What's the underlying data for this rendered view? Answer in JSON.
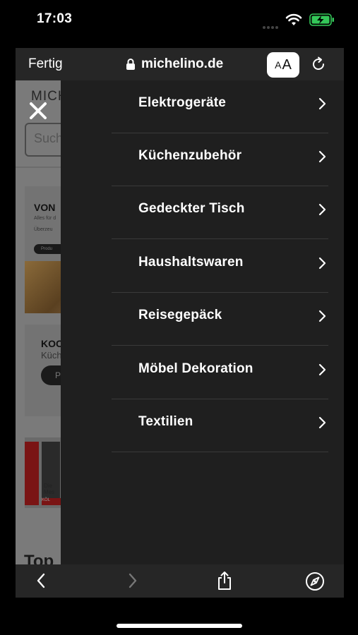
{
  "status": {
    "time": "17:03"
  },
  "safari": {
    "done_label": "Fertig",
    "url": "michelino.de",
    "aa_small": "A",
    "aa_large": "A"
  },
  "page": {
    "logo": "MICH",
    "search_placeholder": "Such",
    "card1_title": "VON",
    "card1_sub": "Alles für d",
    "card1_sub2": "Überzeu",
    "card1_btn": "Produ",
    "card2_title": "KOC",
    "card2_sub": "Küch",
    "card2_btn": "P",
    "card3_text1": "Die",
    "card3_text2": "Mes",
    "card3_bar": "KÖL",
    "heading": "Top"
  },
  "menu": {
    "items": [
      {
        "label": "Elektrogeräte"
      },
      {
        "label": "Küchenzubehör"
      },
      {
        "label": "Gedeckter Tisch"
      },
      {
        "label": "Haushaltswaren"
      },
      {
        "label": "Reisegepäck"
      },
      {
        "label": "Möbel Dekoration"
      },
      {
        "label": "Textilien"
      }
    ]
  },
  "icons": {
    "close": "close-icon",
    "chevron": "chevron-right-icon",
    "lock": "lock-icon",
    "reload": "reload-icon",
    "back": "back-arrow-icon",
    "forward": "forward-arrow-icon",
    "share": "share-icon",
    "compass": "compass-icon"
  },
  "colors": {
    "battery": "#34c759",
    "menu_bg": "#1f1f1f"
  }
}
